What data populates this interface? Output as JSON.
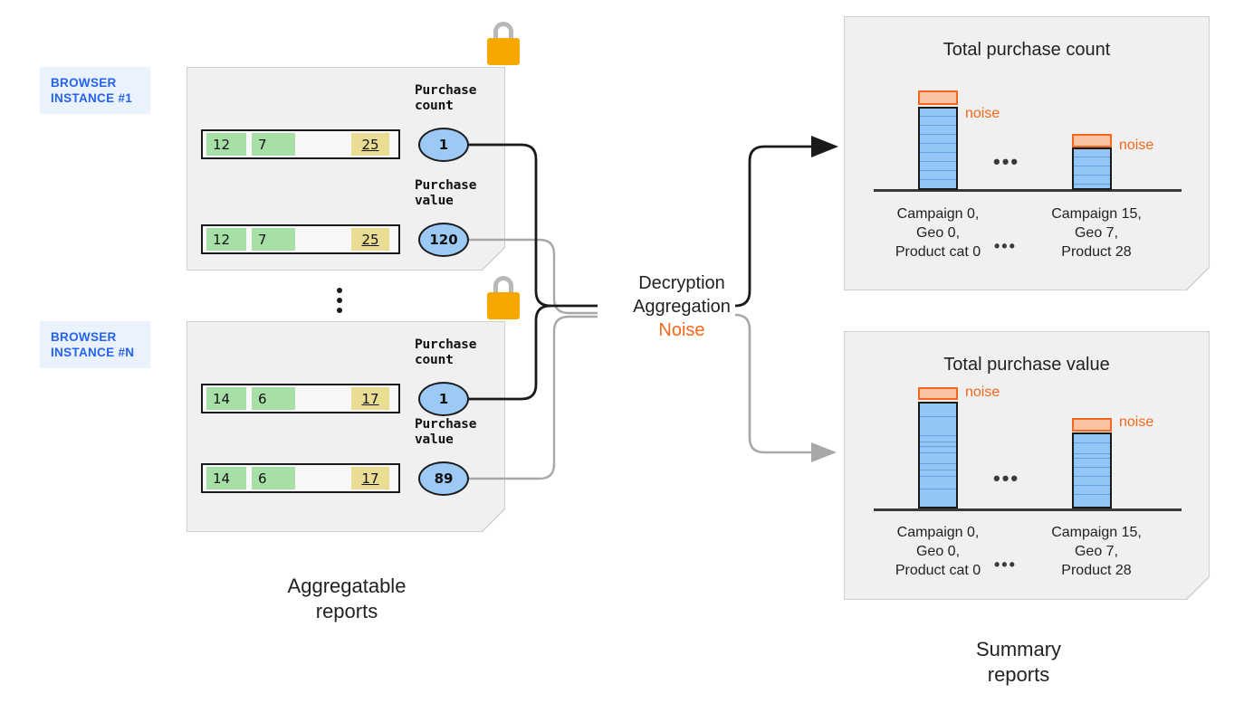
{
  "browser_instances": [
    {
      "tag": "BROWSER\nINSTANCE #1",
      "tag_line1": "BROWSER",
      "tag_line2": "INSTANCE #1",
      "lock_icon": "padlock-icon",
      "reports": [
        {
          "metric_label_line1": "Purchase",
          "metric_label_line2": "count",
          "cells": [
            "12",
            "7",
            "",
            "25"
          ],
          "bubble_value": "1"
        },
        {
          "metric_label_line1": "Purchase",
          "metric_label_line2": "value",
          "cells": [
            "12",
            "7",
            "",
            "25"
          ],
          "bubble_value": "120"
        }
      ]
    },
    {
      "tag_line1": "BROWSER",
      "tag_line2": "INSTANCE #N",
      "lock_icon": "padlock-icon",
      "reports": [
        {
          "metric_label_line1": "Purchase",
          "metric_label_line2": "count",
          "cells": [
            "14",
            "6",
            "",
            "17"
          ],
          "bubble_value": "1"
        },
        {
          "metric_label_line1": "Purchase",
          "metric_label_line2": "value",
          "cells": [
            "14",
            "6",
            "",
            "17"
          ],
          "bubble_value": "89"
        }
      ]
    }
  ],
  "ellipsis_between_instances": "⋮",
  "left_caption_line1": "Aggregatable",
  "left_caption_line2": "reports",
  "right_caption_line1": "Summary",
  "right_caption_line2": "reports",
  "center": {
    "line1": "Decryption",
    "line2": "Aggregation",
    "line3": "Noise"
  },
  "colors": {
    "noise": "#f4671a",
    "bar_fill": "#94c6f5",
    "bar_stroke": "#1a1a1a",
    "noise_fill": "#f9c3a4",
    "lock_body": "#f6a800",
    "lock_shackle": "#b8b8b8",
    "cell_green": "#a6e0a6",
    "cell_yellow": "#e8dd93",
    "bubble_fill": "#9dc9f5",
    "tag_text": "#2563f0",
    "tag_bg": "#eaf2fd",
    "panel_bg": "#f0f0f0",
    "arrow_count": "#1a1a1a",
    "arrow_value": "#a8a8a8"
  },
  "chart_data": [
    {
      "type": "bar",
      "title": "Total purchase count",
      "categories": [
        "Campaign 0,\nGeo 0,\nProduct cat 0",
        "Campaign 15,\nGeo 7,\nProduct 28"
      ],
      "category_lines": [
        [
          "Campaign 0,",
          "Geo 0,",
          "Product cat 0"
        ],
        [
          "Campaign 15,",
          "Geo 7,",
          "Product 28"
        ]
      ],
      "values": [
        9,
        5
      ],
      "noise_values": [
        1,
        1
      ],
      "stripes_per_bar": [
        9,
        5
      ],
      "annotations": [
        "noise",
        "noise"
      ],
      "ellipsis": "•••",
      "xlabel": "",
      "ylabel": "",
      "grid": false,
      "legend": "none"
    },
    {
      "type": "bar",
      "title": "Total purchase value",
      "categories": [
        "Campaign 0,\nGeo 0,\nProduct cat 0",
        "Campaign 15,\nGeo 7,\nProduct 28"
      ],
      "category_lines": [
        [
          "Campaign 0,",
          "Geo 0,",
          "Product cat 0"
        ],
        [
          "Campaign 15,",
          "Geo 7,",
          "Product 28"
        ]
      ],
      "values": [
        10,
        7
      ],
      "noise_values": [
        1,
        1
      ],
      "stripe_positions": [
        [
          0.12,
          0.3,
          0.36,
          0.4,
          0.46,
          0.56,
          0.62,
          0.68,
          0.8
        ],
        [
          0.1,
          0.24,
          0.3,
          0.42,
          0.54,
          0.66,
          0.78
        ]
      ],
      "annotations": [
        "noise",
        "noise"
      ],
      "ellipsis": "•••",
      "xlabel": "",
      "ylabel": "",
      "grid": false,
      "legend": "none"
    }
  ]
}
